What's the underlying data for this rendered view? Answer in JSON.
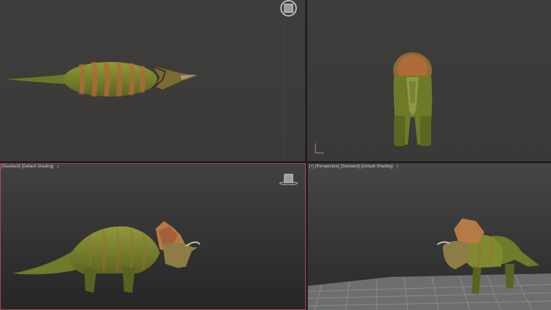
{
  "viewports": [
    {
      "id": "top",
      "label_parts": []
    },
    {
      "id": "front",
      "label_parts": []
    },
    {
      "id": "left",
      "label_parts": [
        "[Standard]",
        "[Default Shading]"
      ],
      "filter_icon": "filter-icon"
    },
    {
      "id": "perspective",
      "label_parts": [
        "[+]",
        "[Perspective]",
        "[Standard]",
        "[Default Shading]"
      ],
      "filter_icon": "filter-icon"
    }
  ],
  "colors": {
    "active_border": "#b24b63",
    "dino_green": "#7d8a2a",
    "dino_stripe": "#a05a2c",
    "grid": "#8a8a8a"
  },
  "icons": [
    "viewcube-icon",
    "filter-icon",
    "axis-tripod-icon"
  ]
}
